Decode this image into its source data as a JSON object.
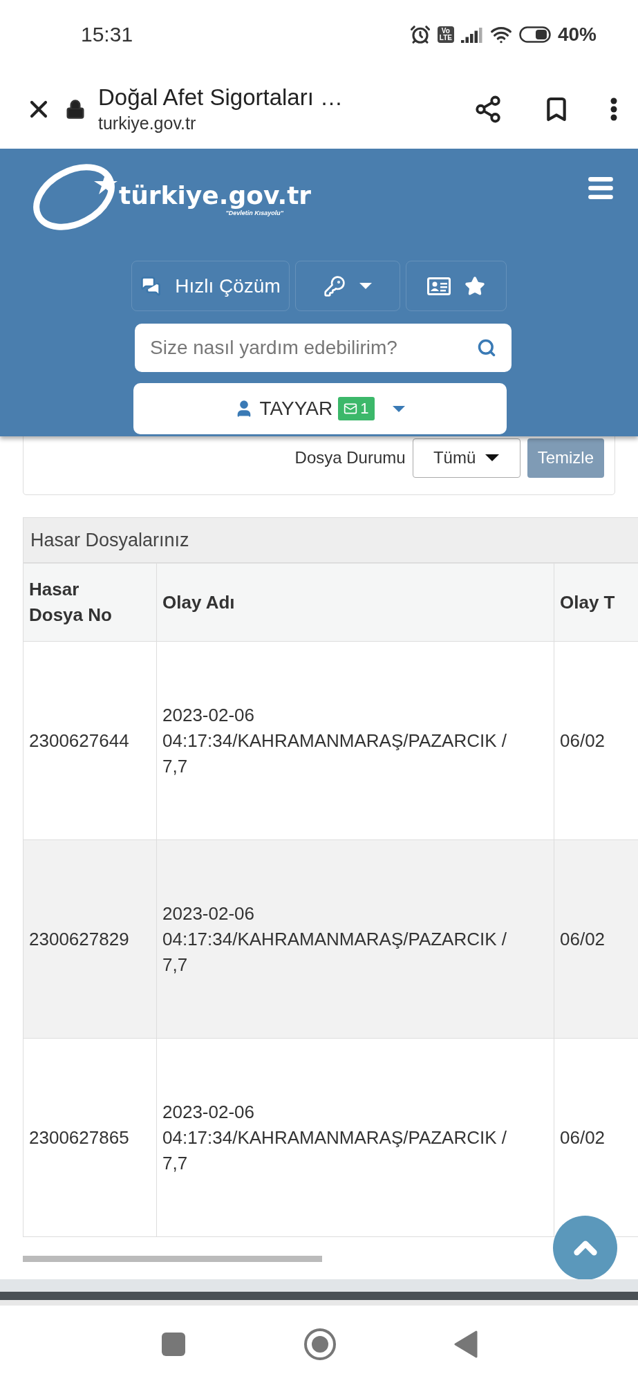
{
  "status_bar": {
    "time": "15:31",
    "network_badge": [
      "Vo",
      "LTE"
    ],
    "battery": "40%"
  },
  "browser_bar": {
    "title": "Doğal Afet Sigortaları …",
    "url": "turkiye.gov.tr"
  },
  "site_header": {
    "logo_text": "türkiye.gov.tr",
    "logo_tagline": "\"Devletin Kısayolu\"",
    "quick_button": "Hızlı Çözüm",
    "search": {
      "placeholder": "Size nasıl yardım edebilirim?"
    },
    "user": {
      "name": "TAYYAR",
      "message_count": "1"
    }
  },
  "filter": {
    "label": "Dosya Durumu",
    "select_value": "Tümü",
    "clear_button": "Temizle"
  },
  "table": {
    "title": "Hasar Dosyalarınız",
    "columns": [
      "Hasar Dosya No",
      "Olay Adı",
      "Olay T"
    ],
    "rows": [
      {
        "file_no": "2300627644",
        "event_name": "2023-02-06 04:17:34/KAHRAMANMARAŞ/PAZARCIK / 7,7",
        "event_date": "06/02"
      },
      {
        "file_no": "2300627829",
        "event_name": "2023-02-06 04:17:34/KAHRAMANMARAŞ/PAZARCIK / 7,7",
        "event_date": "06/02"
      },
      {
        "file_no": "2300627865",
        "event_name": "2023-02-06 04:17:34/KAHRAMANMARAŞ/PAZARCIK / 7,7",
        "event_date": "06/02"
      }
    ]
  }
}
